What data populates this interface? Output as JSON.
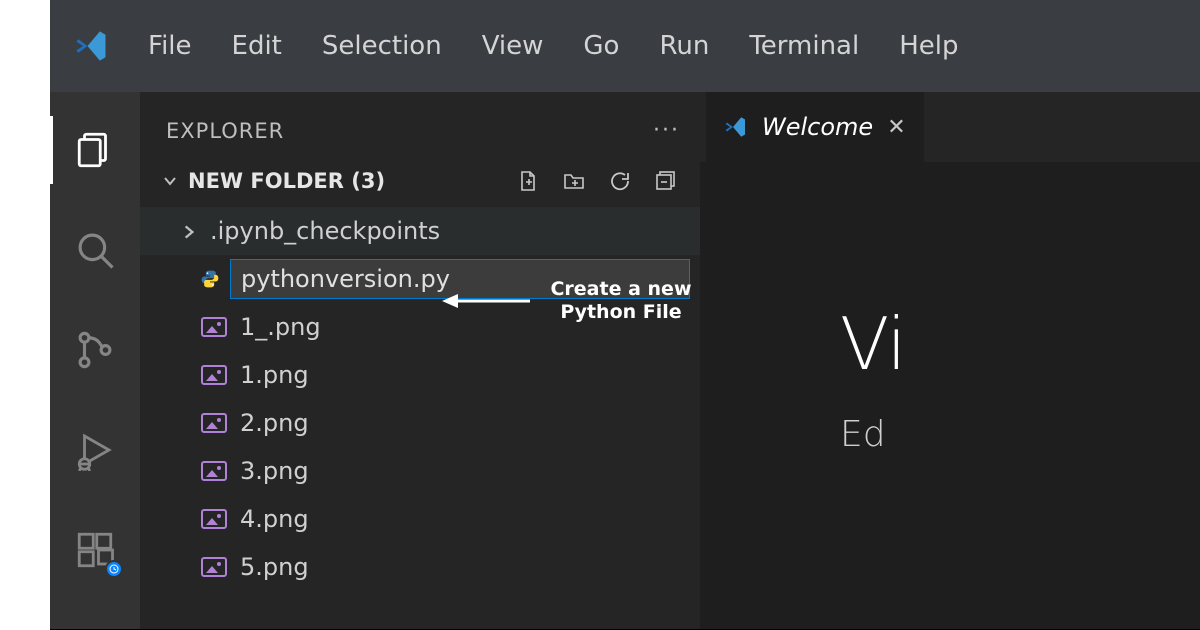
{
  "menu": {
    "items": [
      "File",
      "Edit",
      "Selection",
      "View",
      "Go",
      "Run",
      "Terminal",
      "Help"
    ]
  },
  "activity_bar": {
    "items": [
      {
        "name": "explorer",
        "active": true
      },
      {
        "name": "search",
        "active": false
      },
      {
        "name": "source-control",
        "active": false
      },
      {
        "name": "run-debug",
        "active": false
      },
      {
        "name": "extensions",
        "active": false
      }
    ]
  },
  "sidebar": {
    "title": "EXPLORER",
    "ellipsis": "···",
    "root_folder": "NEW FOLDER (3)",
    "actions": [
      "new-file",
      "new-folder",
      "refresh",
      "collapse-all"
    ],
    "tree": {
      "folders": [
        {
          "name": ".ipynb_checkpoints",
          "expanded": false
        }
      ],
      "new_file_value": "pythonversion.py",
      "files": [
        {
          "name": "1_.png",
          "type": "image"
        },
        {
          "name": "1.png",
          "type": "image"
        },
        {
          "name": "2.png",
          "type": "image"
        },
        {
          "name": "3.png",
          "type": "image"
        },
        {
          "name": "4.png",
          "type": "image"
        },
        {
          "name": "5.png",
          "type": "image"
        }
      ]
    }
  },
  "editor": {
    "tabs": [
      {
        "label": "Welcome",
        "active": true
      }
    ],
    "welcome": {
      "heading_partial": "Vi",
      "subheading_partial": "Ed"
    }
  },
  "annotation": {
    "text": "Create a new Python File"
  }
}
